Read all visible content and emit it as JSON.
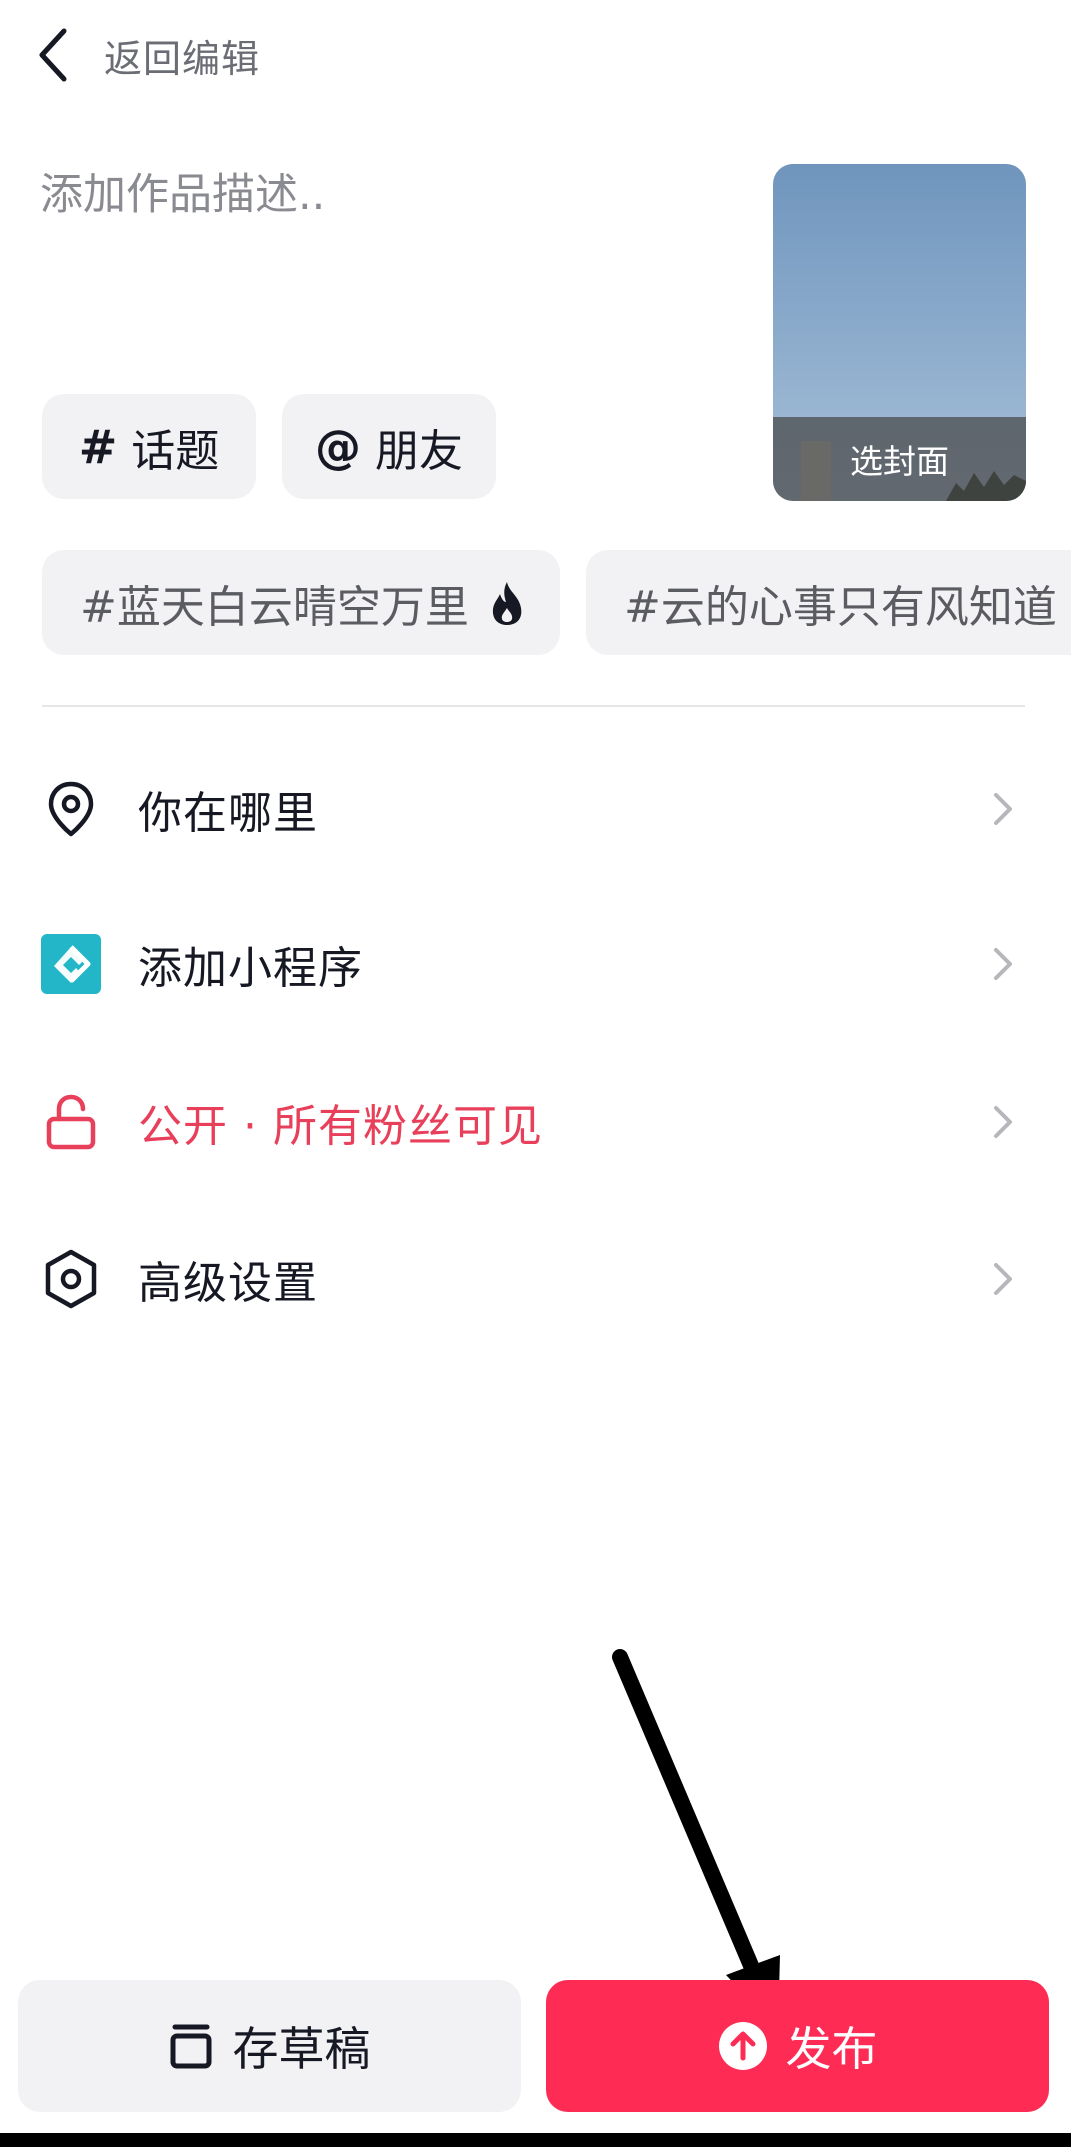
{
  "header": {
    "back_label": "返回编辑"
  },
  "description": {
    "placeholder": "添加作品描述.."
  },
  "cover": {
    "label": "选封面"
  },
  "chips": {
    "topic_symbol": "#",
    "topic_label": "话题",
    "friend_symbol": "@",
    "friend_label": "朋友"
  },
  "suggested_topics": [
    {
      "label": "#蓝天白云晴空万里",
      "hot": true
    },
    {
      "label": "#云的心事只有风知道"
    }
  ],
  "menu": {
    "location": {
      "label": "你在哪里",
      "icon": "location-pin-icon"
    },
    "mini_program": {
      "label": "添加小程序",
      "icon": "mini-program-icon"
    },
    "privacy": {
      "label": "公开 · 所有粉丝可见",
      "icon": "unlock-icon",
      "color": "#e8405a"
    },
    "advanced": {
      "label": "高级设置",
      "icon": "settings-hexagon-icon"
    }
  },
  "bottom": {
    "draft_label": "存草稿",
    "publish_label": "发布"
  },
  "colors": {
    "accent": "#fe2c55",
    "chip_bg": "#f2f2f4",
    "mini_program": "#22b6c8",
    "text": "#161823"
  }
}
